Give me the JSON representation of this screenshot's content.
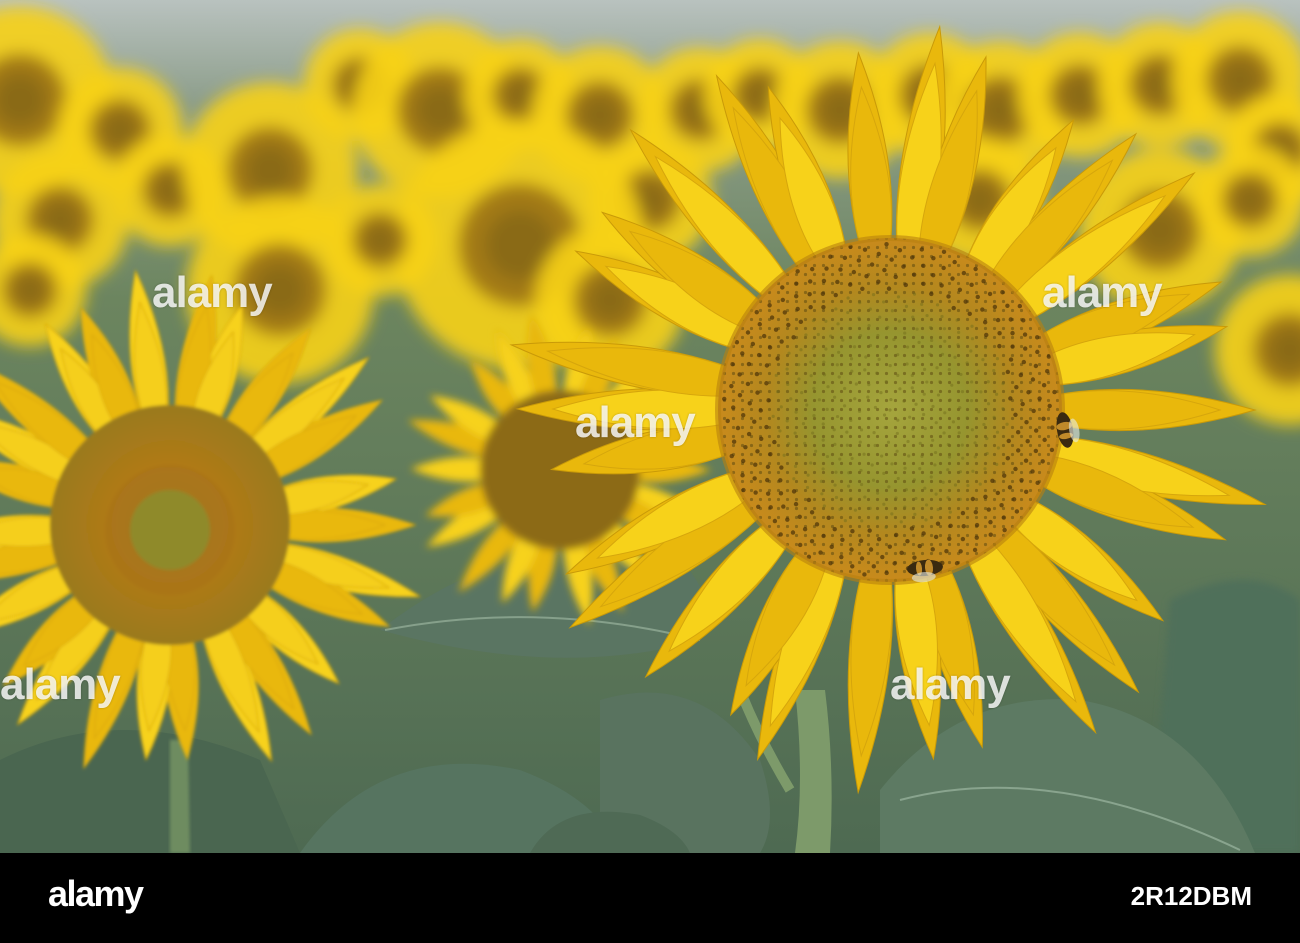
{
  "watermark": {
    "text": "alamy",
    "large_tiles": [
      "alamy",
      "alamy",
      "alamy",
      "alamy",
      "alamy",
      "alamy"
    ],
    "small_tile": "a"
  },
  "footer": {
    "brand": "alamy",
    "image_id": "2R12DBM"
  },
  "scene": {
    "subject": "sunflower",
    "colors": {
      "petal": "#f7d21a",
      "petal_shade": "#e9b80c",
      "disk_outer": "#c98a1c",
      "disk_inner": "#9a9a33",
      "leaf": "#4f6e55",
      "leaf_light": "#6f8a72",
      "background_blur": "#5f7a5e",
      "sky": "#b9c2bf"
    }
  }
}
